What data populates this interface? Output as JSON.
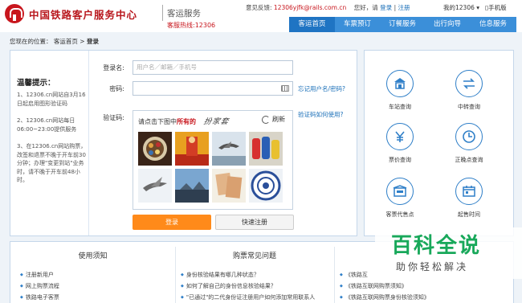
{
  "header": {
    "brand_name": "中国铁路客户服务中心",
    "brand_sub": "客运服务",
    "hotline": "客服热线:12306",
    "feedback_label": "意见反馈:",
    "feedback_email": "12306yjfk@rails.com.cn",
    "greeting": "您好，请",
    "login_link": "登录",
    "separator": "|",
    "register_link": "注册",
    "my12306": "我的12306 ▾",
    "mobile": "手机版"
  },
  "nav": {
    "items": [
      "客运首页",
      "车票预订",
      "订餐服务",
      "出行向导",
      "信息服务"
    ],
    "active_index": 0
  },
  "breadcrumb": {
    "prefix": "您现在的位置：",
    "home": "客运首页",
    "arrow": ">",
    "current": "登录"
  },
  "tips": {
    "title": "温馨提示：",
    "items": [
      "1、12306.cn网站自3月16日起启用图形验证码",
      "2、12306.cn网站每日06:00~23:00提供服务",
      "3、在12306.cn网站购票，改签和退票不晚于开车前30分钟；办理\"变更到站\"业务时，请不晚于开车前48小时。"
    ]
  },
  "login": {
    "username_label": "登录名:",
    "username_placeholder": "用户名／邮箱／手机号",
    "password_label": "密码:",
    "forgot_link": "忘记用户名/密码?",
    "captcha_label": "验证码:",
    "captcha_help_link": "验证码如何使用?",
    "captcha_prompt_prefix": "请点击下图中",
    "captcha_prompt_keyword": "所有的",
    "captcha_word": "扮家套",
    "refresh_label": "刷新",
    "login_button": "登录",
    "quick_register_button": "快速注册"
  },
  "services": [
    {
      "label": "车站查询",
      "icon": "station-icon"
    },
    {
      "label": "中转查询",
      "icon": "transfer-icon"
    },
    {
      "label": "票价查询",
      "icon": "ticket-price-icon"
    },
    {
      "label": "正晚点查询",
      "icon": "clock-icon"
    },
    {
      "label": "客票代售点",
      "icon": "agency-icon"
    },
    {
      "label": "起售时间",
      "icon": "sale-time-icon"
    }
  ],
  "bottom": {
    "col1": {
      "title": "使用须知",
      "items": [
        "注册新用户",
        "网上购票流程",
        "铁路电子客票"
      ]
    },
    "col2": {
      "title": "购票常见问题",
      "items": [
        "身份核验结果有哪几种状态？",
        "如何了解自己的身份信息核验结果？",
        "\"已通过\"的二代身份证注册用户如何添加常用联系人"
      ]
    },
    "col3": {
      "title": "",
      "items": [
        "《铁路互",
        "《铁路互联网购票须知》",
        "《铁路互联网购票身份核验须知》"
      ]
    }
  },
  "watermark": {
    "main": "百科全说",
    "sub": "助你轻松解决"
  },
  "colors": {
    "brand_red": "#c8161d",
    "nav_blue": "#3b8fd9",
    "nav_active": "#1f74c3",
    "login_orange": "#ff8a1a",
    "watermark_green": "#18a85a"
  }
}
